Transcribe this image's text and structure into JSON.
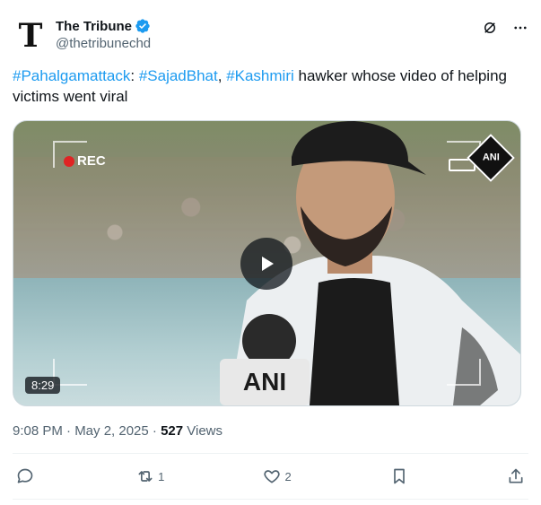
{
  "author": {
    "display_name": "The Tribune",
    "handle": "@thetribunechd",
    "avatar_letter": "T"
  },
  "tweet": {
    "hashtag1": "#Pahalgamattack",
    "sep1": ": ",
    "hashtag2": "#SajadBhat",
    "sep2": ", ",
    "hashtag3": "#Kashmiri",
    "rest": " hawker whose video of helping victims went viral"
  },
  "media": {
    "rec_label": "REC",
    "ani_label": "ANI",
    "mic_label": "ANI",
    "duration": "8:29"
  },
  "meta": {
    "time": "9:08 PM · May 2, 2025 · ",
    "views_count": "527",
    "views_label": " Views"
  },
  "actions": {
    "reply_count": "",
    "retweet_count": "1",
    "like_count": "2"
  },
  "colors": {
    "accent": "#1d9bf0",
    "secondary_text": "#536471"
  }
}
